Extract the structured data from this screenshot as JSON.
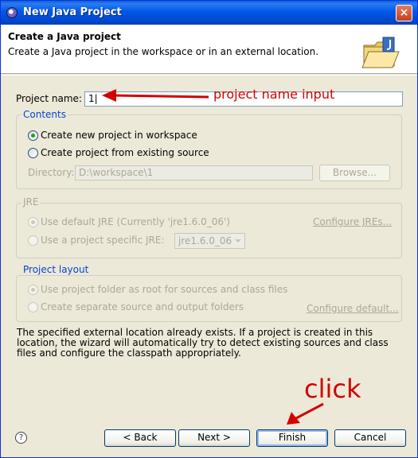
{
  "window": {
    "title": "New Java Project",
    "close_glyph": "×"
  },
  "header": {
    "title": "Create a Java project",
    "description": "Create a Java project in the workspace or in an external location."
  },
  "project_name": {
    "label": "Project name:",
    "value": "1|"
  },
  "contents": {
    "group_label": "Contents",
    "option_new": "Create new project in workspace",
    "option_existing": "Create project from existing source",
    "directory_label": "Directory:",
    "directory_value": "D:\\workspace\\1",
    "browse_label": "Browse..."
  },
  "jre": {
    "group_label": "JRE",
    "option_default": "Use default JRE (Currently 'jre1.6.0_06')",
    "option_specific": "Use a project specific JRE:",
    "specific_value": "jre1.6.0_06",
    "configure_link": "Configure JREs..."
  },
  "layout": {
    "group_label": "Project layout",
    "option_root": "Use project folder as root for sources and class files",
    "option_separate": "Create separate source and output folders",
    "configure_link": "Configure default..."
  },
  "info_message": "The specified external location already exists. If a project is created in this location, the wizard will automatically try to detect existing sources and class files and configure the classpath appropriately.",
  "buttons": {
    "help": "?",
    "back": "< Back",
    "next": "Next >",
    "finish": "Finish",
    "cancel": "Cancel"
  },
  "annotations": {
    "project_name_note": "project name input",
    "click_note": "click",
    "color": "#d40000"
  }
}
